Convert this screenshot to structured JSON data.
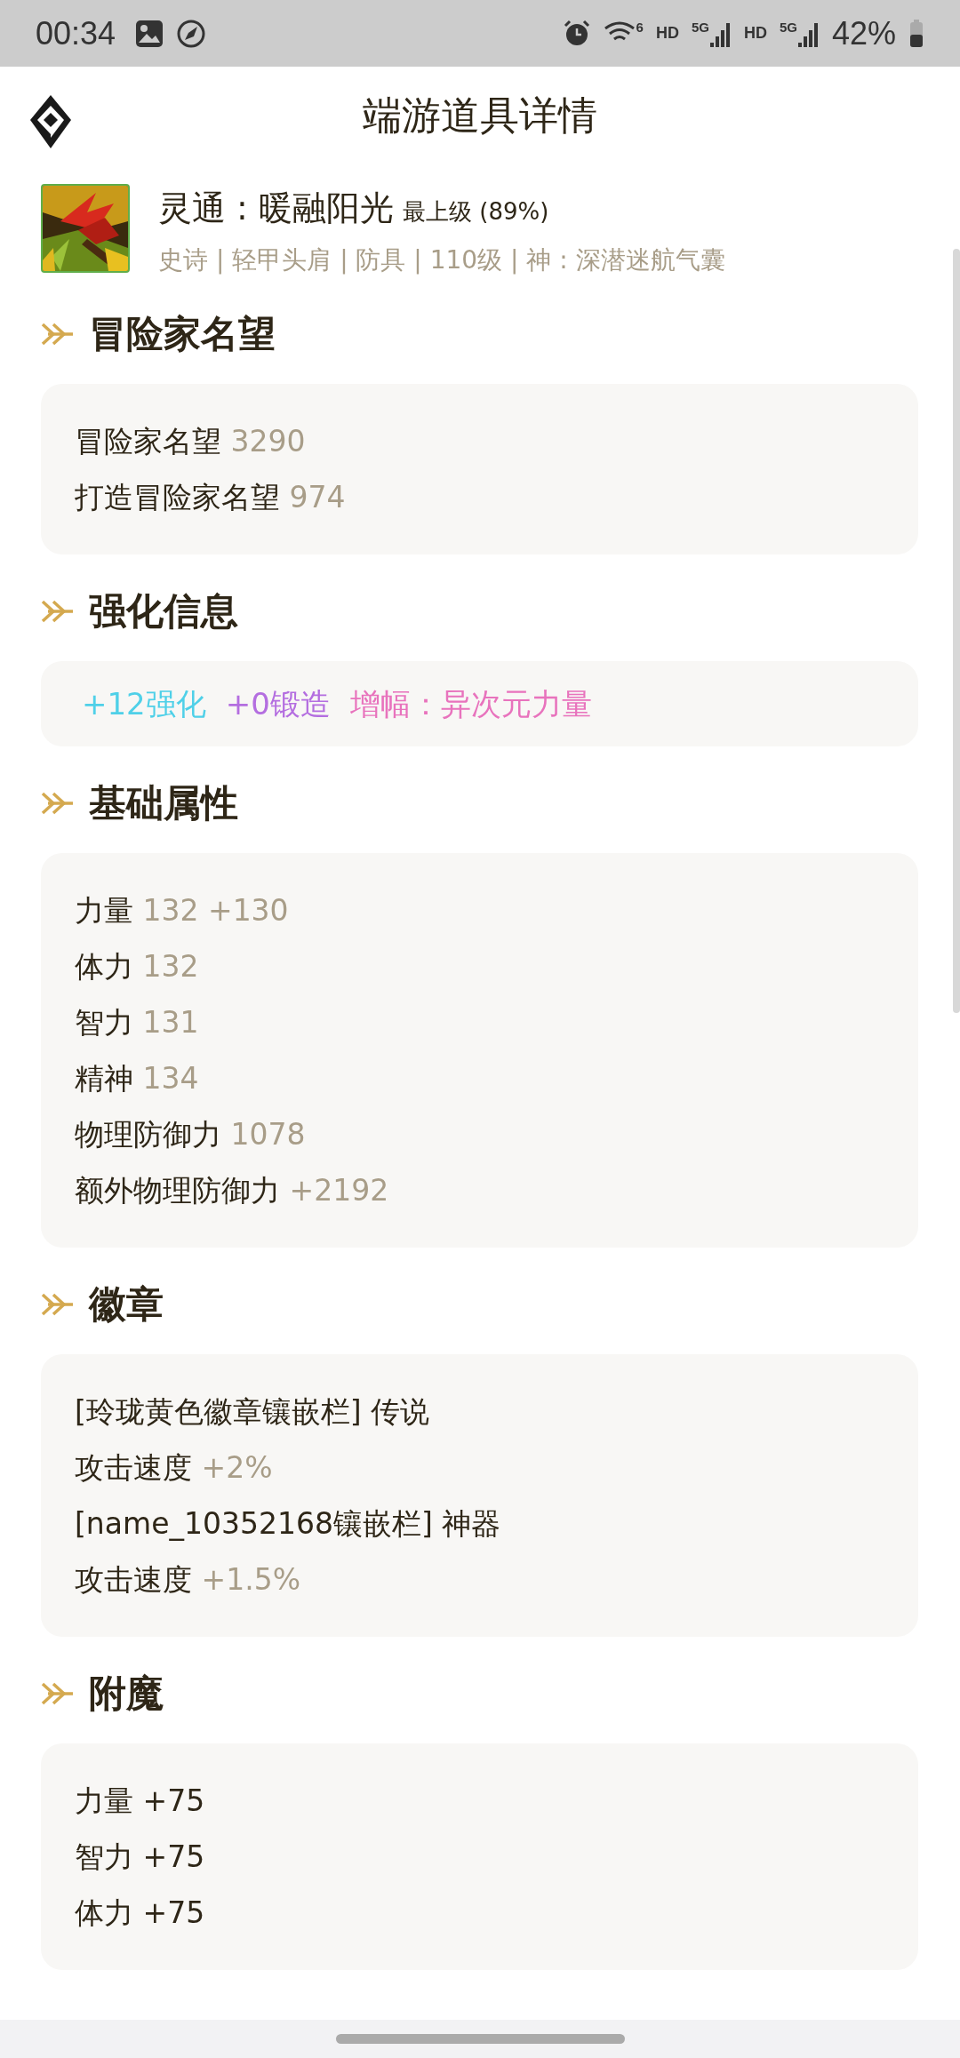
{
  "status_bar": {
    "time": "00:34",
    "wifi_label": "6",
    "networks": [
      {
        "hd": "HD",
        "gen": "5G"
      },
      {
        "hd": "HD",
        "gen": "5G"
      }
    ],
    "battery": "42%"
  },
  "header": {
    "title": "端游道具详情"
  },
  "item": {
    "name": "灵通 : 暖融阳光",
    "grade": "最上级 (89%)",
    "meta": "史诗 | 轻甲头肩 | 防具 | 110级 | 神 : 深潜迷航气囊"
  },
  "sections": [
    {
      "title": "冒险家名望",
      "kind": "lines",
      "lines": [
        {
          "label": "冒险家名望",
          "value": "3290"
        },
        {
          "label": "打造冒险家名望",
          "value": "974"
        }
      ]
    },
    {
      "title": "强化信息",
      "kind": "tags",
      "tags": [
        {
          "text": "+12强化",
          "color": "#4fd0e8"
        },
        {
          "text": "+0锻造",
          "color": "#b46ee0"
        },
        {
          "text": "增幅：异次元力量",
          "color": "#e873bd"
        }
      ]
    },
    {
      "title": "基础属性",
      "kind": "lines",
      "lines": [
        {
          "label": "力量",
          "value": "132 +130"
        },
        {
          "label": "体力",
          "value": "132"
        },
        {
          "label": "智力",
          "value": "131"
        },
        {
          "label": "精神",
          "value": "134"
        },
        {
          "label": "物理防御力",
          "value": "1078"
        },
        {
          "label": "额外物理防御力",
          "value": "+2192"
        }
      ]
    },
    {
      "title": "徽章",
      "kind": "lines",
      "lines": [
        {
          "label": "[玲珑黄色徽章镶嵌栏] 传说"
        },
        {
          "label": "攻击速度",
          "value": "+2%"
        },
        {
          "label": "[name_10352168镶嵌栏] 神器"
        },
        {
          "label": "攻击速度",
          "value": "+1.5%"
        }
      ]
    },
    {
      "title": "附魔",
      "kind": "lines",
      "lines": [
        {
          "label": "力量 +75"
        },
        {
          "label": "智力 +75"
        },
        {
          "label": "体力 +75"
        }
      ]
    }
  ]
}
